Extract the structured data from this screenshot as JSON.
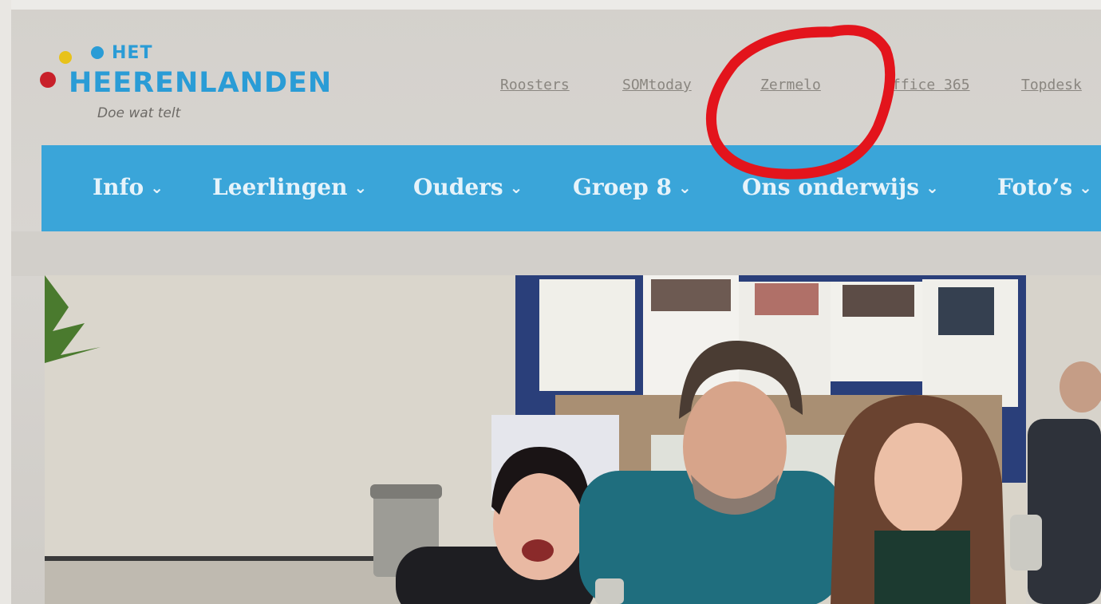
{
  "logo": {
    "het": "HET",
    "name": "HEERENLANDEN",
    "tagline": "Doe wat telt"
  },
  "top_links": [
    {
      "label": "Roosters"
    },
    {
      "label": "SOMtoday"
    },
    {
      "label": "Zermelo"
    },
    {
      "label": "ffice 365"
    },
    {
      "label": "Topdesk"
    }
  ],
  "nav": [
    {
      "label": "Info"
    },
    {
      "label": "Leerlingen"
    },
    {
      "label": "Ouders"
    },
    {
      "label": "Groep 8"
    },
    {
      "label": "Ons onderwijs"
    },
    {
      "label": "Foto’s"
    }
  ],
  "hero": {
    "subject": "photo-three-people-with-trophies"
  },
  "colors": {
    "brand_blue": "#2a9cd6",
    "nav_blue": "#3aa5d9",
    "logo_yellow": "#e8c21a",
    "logo_red": "#c8202a",
    "annotation_red": "#e3141c"
  },
  "icons": {
    "nav_dropdown": "chevron-down-icon"
  }
}
